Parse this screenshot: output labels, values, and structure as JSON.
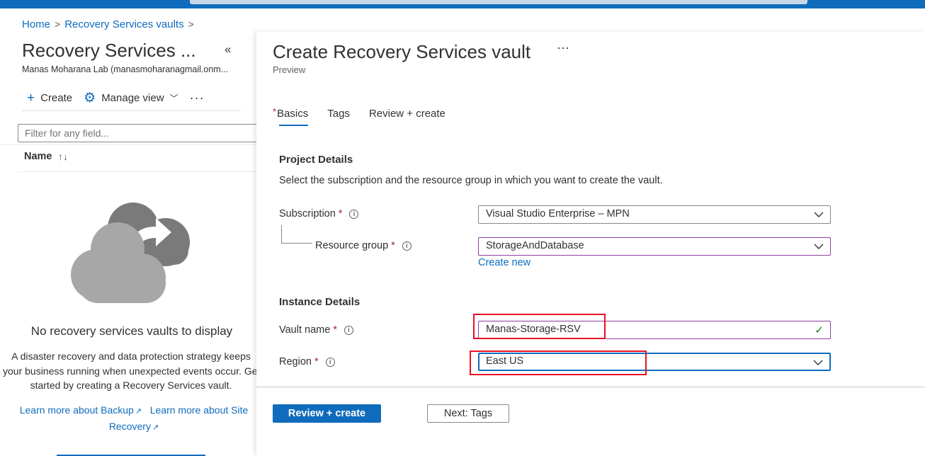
{
  "breadcrumb": {
    "home": "Home",
    "vaults": "Recovery Services vaults"
  },
  "left": {
    "title": "Recovery Services ...",
    "subtitle": "Manas Moharana Lab (manasmoharanagmail.onm...",
    "commands": {
      "create": "Create",
      "manage_view": "Manage view",
      "more": "···"
    },
    "filter_placeholder": "Filter for any field...",
    "column_name": "Name",
    "empty_title": "No recovery services vaults to display",
    "empty_desc_lines": [
      "A disaster recovery and data protection strategy keeps",
      "your business running when unexpected events occur. Get",
      "started by creating a Recovery Services vault."
    ],
    "link_backup": "Learn more about Backup",
    "link_site_recovery_1": "Learn more about Site",
    "link_site_recovery_2": "Recovery"
  },
  "blade": {
    "title": "Create Recovery Services vault",
    "more": "···",
    "subtitle": "Preview",
    "tabs": [
      {
        "label": "Basics",
        "required": true,
        "active": true
      },
      {
        "label": "Tags"
      },
      {
        "label": "Review + create"
      }
    ],
    "project_details": {
      "title": "Project Details",
      "desc": "Select the subscription and the resource group in which you want to create the vault.",
      "subscription_label": "Subscription",
      "subscription_value": "Visual Studio Enterprise – MPN",
      "resource_group_label": "Resource group",
      "resource_group_value": "StorageAndDatabase",
      "create_new": "Create new"
    },
    "instance_details": {
      "title": "Instance Details",
      "vault_name_label": "Vault name",
      "vault_name_value": "Manas-Storage-RSV",
      "region_label": "Region",
      "region_value": "East US"
    },
    "required_mark": "*",
    "buttons": {
      "review_create": "Review + create",
      "next": "Next: Tags"
    }
  },
  "colors": {
    "accent": "#0f6cbd",
    "required": "#a4262c",
    "highlight": "#e81123"
  }
}
